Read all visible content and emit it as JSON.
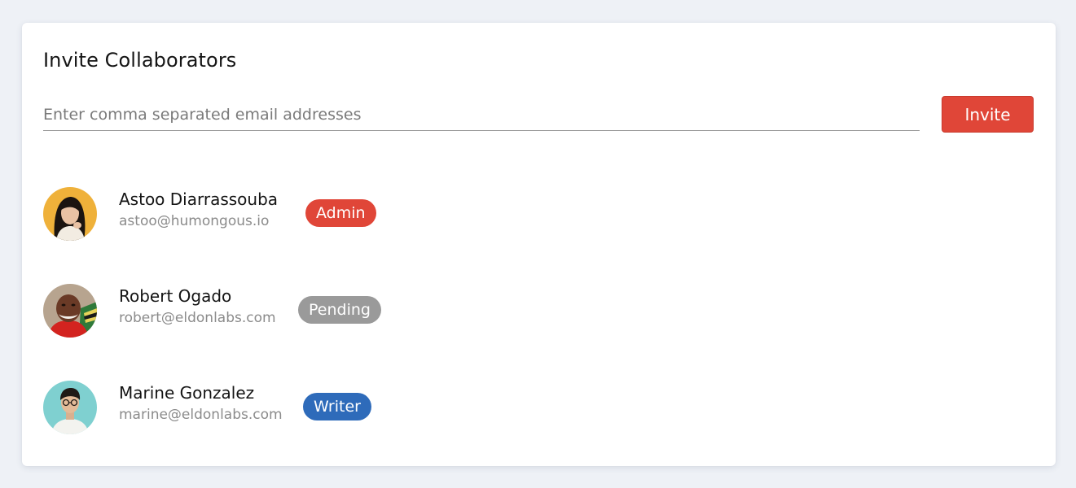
{
  "invite": {
    "title": "Invite Collaborators",
    "input_placeholder": "Enter comma separated email addresses",
    "input_value": "",
    "button_label": "Invite"
  },
  "colors": {
    "accent_red": "#e04638",
    "pending_gray": "#9a9a9a",
    "writer_blue": "#2e6bba",
    "page_background": "#eef1f6"
  },
  "collaborators": [
    {
      "name": "Astoo Diarrassouba",
      "email": "astoo@humongous.io",
      "role": "Admin",
      "role_color": "#e04638",
      "avatar_icon": "avatar-photo-woman"
    },
    {
      "name": "Robert Ogado",
      "email": "robert@eldonlabs.com",
      "role": "Pending",
      "role_color": "#9a9a9a",
      "avatar_icon": "avatar-photo-man"
    },
    {
      "name": "Marine Gonzalez",
      "email": "marine@eldonlabs.com",
      "role": "Writer",
      "role_color": "#2e6bba",
      "avatar_icon": "avatar-photo-person"
    }
  ]
}
